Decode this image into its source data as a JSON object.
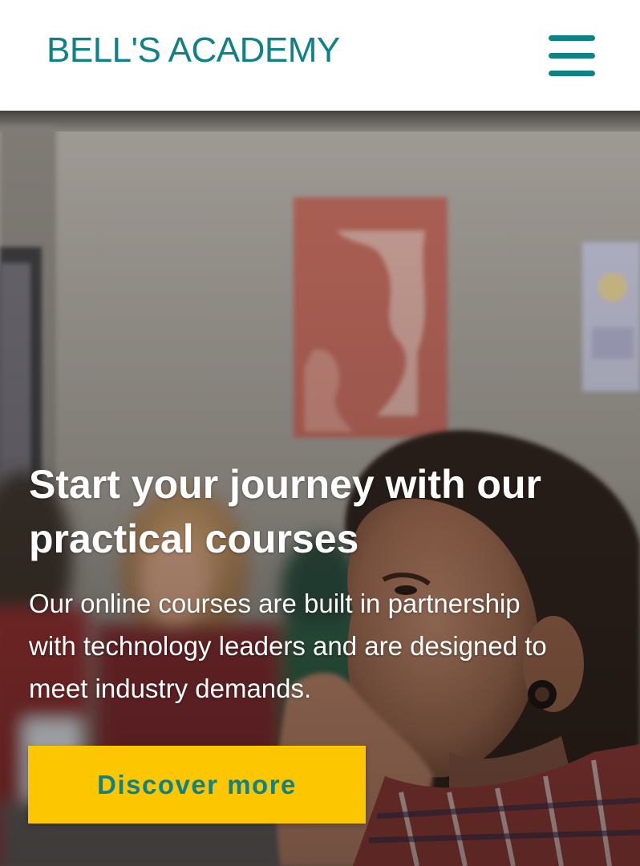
{
  "header": {
    "brand": "BELL'S ACADEMY",
    "menu_icon": "hamburger-menu-icon"
  },
  "hero": {
    "title_line1": "Start your journey with our",
    "title_line2": "practical courses",
    "subtitle_line1": "Our online courses are built in partnership",
    "subtitle_line2": "with technology leaders and are designed to",
    "subtitle_line3": "meet industry demands.",
    "cta_label": "Discover more",
    "image": "classroom-students-photo"
  },
  "colors": {
    "brand_teal": "#0f8288",
    "cta_yellow": "#fcc600",
    "hero_text": "#ffffff"
  }
}
